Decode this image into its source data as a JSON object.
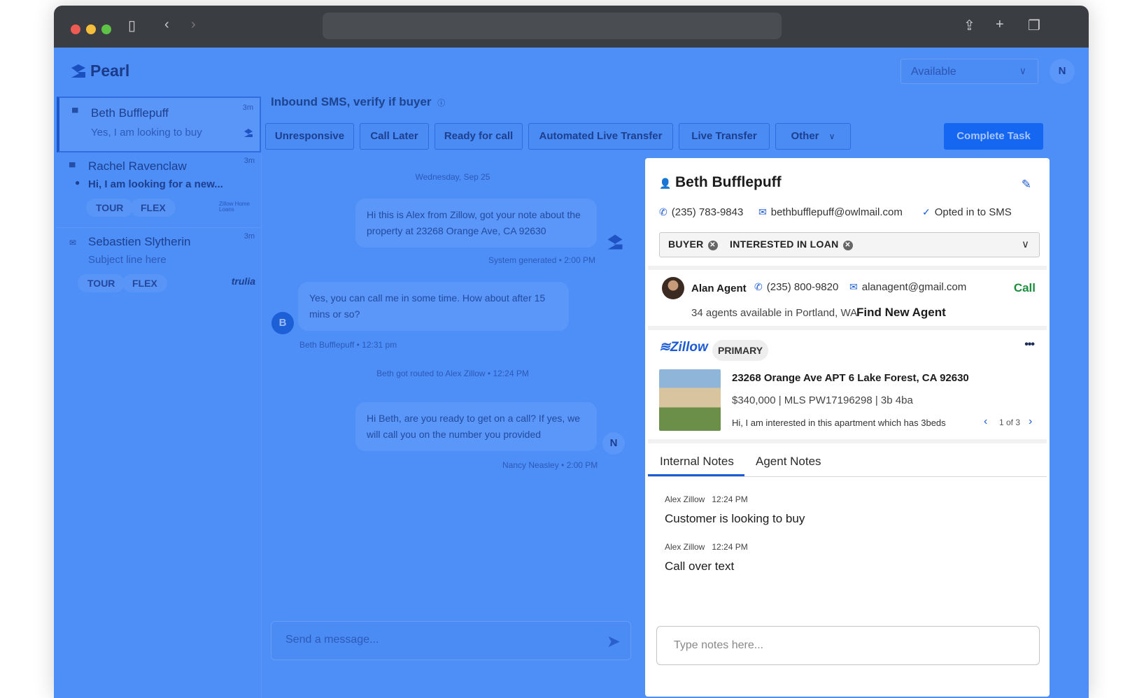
{
  "app": {
    "brand": "Pearl",
    "status": "Available",
    "user_initial": "N"
  },
  "conversations": [
    {
      "name": "Beth Bufflepuff",
      "time": "3m",
      "preview": "Yes, I am looking to buy"
    },
    {
      "name": "Rachel Ravenclaw",
      "time": "3m",
      "preview": "Hi, I am looking for a new...",
      "tags": [
        "TOUR",
        "FLEX"
      ],
      "source": "Zillow Home Loans"
    },
    {
      "name": "Sebastien Slytherin",
      "time": "3m",
      "preview": "Subject line here",
      "tags": [
        "TOUR",
        "FLEX"
      ],
      "source": "trulia"
    }
  ],
  "task": {
    "title": "Inbound SMS, verify if buyer",
    "actions": [
      "Unresponsive",
      "Call Later",
      "Ready for call",
      "Automated Live Transfer",
      "Live Transfer",
      "Other"
    ],
    "complete_label": "Complete Task"
  },
  "chat": {
    "date": "Wednesday, Sep 25",
    "messages": [
      {
        "text": "Hi this is Alex from Zillow, got your note about the property at 23268 Orange Ave, CA 92630",
        "meta": "System generated • 2:00 PM"
      },
      {
        "text": "Yes, you can call me in some time. How about after 15 mins or so?",
        "meta": "Beth Bufflepuff • 12:31 pm",
        "avatar": "B"
      },
      {
        "text": "Hi Beth, are you ready to get on a call? If yes, we will call you on the number you provided",
        "meta": "Nancy Neasley • 2:00 PM",
        "avatar": "N"
      }
    ],
    "routed": "Beth got routed to Alex Zillow • 12:24 PM",
    "input_placeholder": "Send a message..."
  },
  "contact": {
    "name": "Beth Bufflepuff",
    "phone": "(235) 783-9843",
    "email": "bethbufflepuff@owlmail.com",
    "sms": "Opted in to SMS",
    "tags": [
      "BUYER",
      "INTERESTED IN LOAN"
    ]
  },
  "agent": {
    "name": "Alan Agent",
    "phone": "(235) 800-9820",
    "email": "alanagent@gmail.com",
    "call_label": "Call",
    "availability": "34 agents available in Portland, WA",
    "find_label": "Find New Agent"
  },
  "listing": {
    "source": "Zillow",
    "badge": "PRIMARY",
    "more": "•••",
    "address": "23268 Orange Ave APT 6 Lake Forest, CA 92630",
    "details": "$340,000 | MLS PW17196298 | 3b 4ba",
    "note": "Hi, I am interested in this apartment which has 3beds",
    "pager": "1 of 3"
  },
  "notes": {
    "tabs": [
      "Internal Notes",
      "Agent Notes"
    ],
    "items": [
      {
        "author": "Alex Zillow",
        "time": "12:24 PM",
        "text": "Customer is looking to buy"
      },
      {
        "author": "Alex Zillow",
        "time": "12:24 PM",
        "text": "Call over text"
      }
    ],
    "input_placeholder": "Type notes here..."
  },
  "colors": {
    "app_bg": "#4d8ef7",
    "accent": "#1566f0",
    "call_green": "#1e8e3e"
  }
}
